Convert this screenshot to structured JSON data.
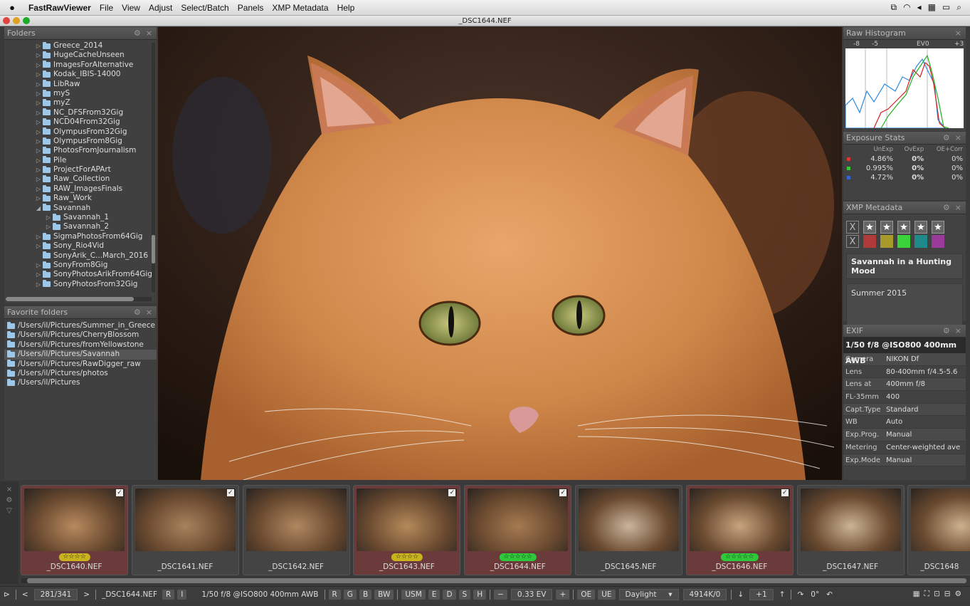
{
  "menubar": {
    "app": "FastRawViewer",
    "items": [
      "File",
      "View",
      "Adjust",
      "Select/Batch",
      "Panels",
      "XMP Metadata",
      "Help"
    ]
  },
  "window": {
    "title": "_DSC1644.NEF"
  },
  "folders": {
    "title": "Folders",
    "items": [
      {
        "label": "Greece_2014",
        "indent": 0,
        "arrow": "▷"
      },
      {
        "label": "HugeCacheUnseen",
        "indent": 0,
        "arrow": "▷"
      },
      {
        "label": "ImagesForAlternative",
        "indent": 0,
        "arrow": "▷"
      },
      {
        "label": "Kodak_IBIS-14000",
        "indent": 0,
        "arrow": "▷"
      },
      {
        "label": "LibRaw",
        "indent": 0,
        "arrow": "▷"
      },
      {
        "label": "myS",
        "indent": 0,
        "arrow": "▷"
      },
      {
        "label": "myZ",
        "indent": 0,
        "arrow": "▷"
      },
      {
        "label": "NC_DFSFrom32Gig",
        "indent": 0,
        "arrow": "▷"
      },
      {
        "label": "NCD04From32Gig",
        "indent": 0,
        "arrow": "▷"
      },
      {
        "label": "OlympusFrom32Gig",
        "indent": 0,
        "arrow": "▷"
      },
      {
        "label": "OlympusFrom8Gig",
        "indent": 0,
        "arrow": "▷"
      },
      {
        "label": "PhotosFromJournalism",
        "indent": 0,
        "arrow": "▷"
      },
      {
        "label": "Pile",
        "indent": 0,
        "arrow": "▷"
      },
      {
        "label": "ProjectForAPArt",
        "indent": 0,
        "arrow": "▷"
      },
      {
        "label": "Raw_Collection",
        "indent": 0,
        "arrow": "▷"
      },
      {
        "label": "RAW_ImagesFinals",
        "indent": 0,
        "arrow": "▷"
      },
      {
        "label": "Raw_Work",
        "indent": 0,
        "arrow": "▷"
      },
      {
        "label": "Savannah",
        "indent": 0,
        "arrow": "◢"
      },
      {
        "label": "Savannah_1",
        "indent": 1,
        "arrow": "▷"
      },
      {
        "label": "Savannah_2",
        "indent": 1,
        "arrow": "▷"
      },
      {
        "label": "SigmaPhotosFrom64Gig",
        "indent": 0,
        "arrow": "▷"
      },
      {
        "label": "Sony_Rio4Vid",
        "indent": 0,
        "arrow": "▷"
      },
      {
        "label": "SonyArik_C...March_2016",
        "indent": 0,
        "arrow": ""
      },
      {
        "label": "SonyFrom8Gig",
        "indent": 0,
        "arrow": "▷"
      },
      {
        "label": "SonyPhotosArikFrom64Gig",
        "indent": 0,
        "arrow": "▷"
      },
      {
        "label": "SonyPhotosFrom32Gig",
        "indent": 0,
        "arrow": "▷"
      }
    ]
  },
  "favorites": {
    "title": "Favorite folders",
    "items": [
      "/Users/il/Pictures/Summer_in_Greece",
      "/Users/il/Pictures/CherryBlossom",
      "/Users/il/Pictures/fromYellowstone",
      "/Users/il/Pictures/Savannah",
      "/Users/il/Pictures/RawDigger_raw",
      "/Users/il/Pictures/photos",
      "/Users/il/Pictures"
    ],
    "selected": 3
  },
  "histogram": {
    "title": "Raw Histogram",
    "ticks": [
      "-8",
      "-5",
      "EV0",
      "+3"
    ]
  },
  "exposure": {
    "title": "Exposure Stats",
    "cols": [
      "UnExp",
      "OvExp",
      "OE+Corr"
    ],
    "rows": [
      {
        "c": "#d33",
        "vals": [
          "4.86%",
          "0%",
          "0%"
        ]
      },
      {
        "c": "#3c3",
        "vals": [
          "0.995%",
          "0%",
          "0%"
        ]
      },
      {
        "c": "#36d",
        "vals": [
          "4.72%",
          "0%",
          "0%"
        ]
      }
    ]
  },
  "xmp": {
    "title": "XMP Metadata",
    "reject": "X",
    "clear": "X",
    "star": "★",
    "colors": [
      "#b03a3a",
      "#a89a2a",
      "#3ad43a",
      "#1f8a8a",
      "#9a3a9a"
    ],
    "titleText": "Savannah in a Hunting Mood",
    "desc": "Summer 2015"
  },
  "exif": {
    "title": "EXIF",
    "summary": "1/50 f/8 @ISO800 400mm AWB",
    "rows": [
      [
        "Camera",
        "NIKON Df"
      ],
      [
        "Lens",
        "80-400mm f/4.5-5.6"
      ],
      [
        "Lens at",
        "400mm f/8"
      ],
      [
        "FL-35mm",
        "400"
      ],
      [
        "Capt.Type",
        "Standard"
      ],
      [
        "WB",
        "Auto"
      ],
      [
        "Exp.Prog.",
        "Manual"
      ],
      [
        "Metering",
        "Center-weighted ave"
      ],
      [
        "Exp.Mode",
        "Manual"
      ]
    ]
  },
  "filmstrip": [
    {
      "name": "_DSC1640.NEF",
      "red": true,
      "check": true,
      "stars": "☆☆☆☆",
      "sc": "#c8b21e"
    },
    {
      "name": "_DSC1641.NEF",
      "red": false,
      "check": true,
      "stars": "",
      "sc": ""
    },
    {
      "name": "_DSC1642.NEF",
      "red": false,
      "check": false,
      "stars": "",
      "sc": ""
    },
    {
      "name": "_DSC1643.NEF",
      "red": true,
      "check": true,
      "stars": "☆☆☆☆",
      "sc": "#c8b21e"
    },
    {
      "name": "_DSC1644.NEF",
      "red": true,
      "check": true,
      "stars": "☆☆☆☆☆",
      "sc": "#2ec83a"
    },
    {
      "name": "_DSC1645.NEF",
      "red": false,
      "check": false,
      "stars": "",
      "sc": ""
    },
    {
      "name": "_DSC1646.NEF",
      "red": true,
      "check": true,
      "stars": "☆☆☆☆☆",
      "sc": "#2ec83a"
    },
    {
      "name": "_DSC1647.NEF",
      "red": false,
      "check": false,
      "stars": "",
      "sc": ""
    },
    {
      "name": "_DSC1648",
      "red": false,
      "check": false,
      "stars": "",
      "sc": ""
    }
  ],
  "status": {
    "counter": "281/341",
    "file": "_DSC1644.NEF",
    "r": "R",
    "i": "I",
    "exif": "1/50 f/8 @ISO800 400mm AWB",
    "rgb": [
      "R",
      "G",
      "B",
      "BW"
    ],
    "usm": "USM",
    "modes": [
      "E",
      "D",
      "S",
      "H"
    ],
    "minus": "−",
    "ev": "0.33 EV",
    "plus": "+",
    "oe": "OE",
    "ue": "UE",
    "wb": "Daylight",
    "kelvin": "4914K/0",
    "step": "+1",
    "rot": "0°"
  }
}
